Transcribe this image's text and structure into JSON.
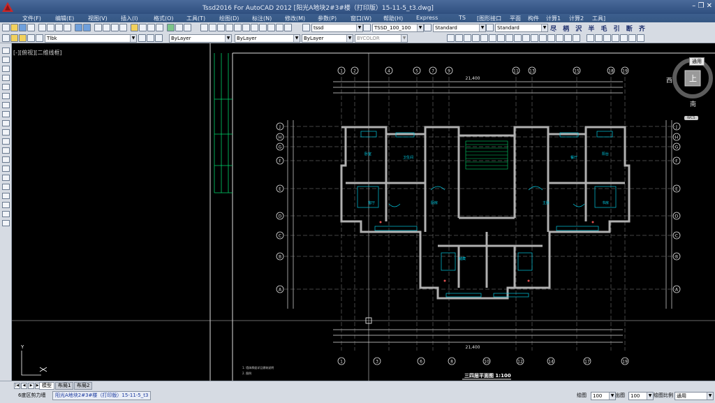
{
  "window": {
    "title": "Tssd2016 For AutoCAD 2012   [阳光A地块2#3#楼（打印版）15-11-5_t3.dwg]",
    "controls": "– ❐ ✕"
  },
  "menu": [
    "文件(F)",
    "编辑(E)",
    "视图(V)",
    "插入(I)",
    "格式(O)",
    "工具(T)",
    "绘图(D)",
    "标注(N)",
    "修改(M)",
    "参数(P)",
    "窗口(W)",
    "帮助(H)",
    "Express",
    "TS",
    "[图形接口",
    "平面",
    "构件",
    "计算1",
    "计算2",
    "工具]"
  ],
  "toolbar1": {
    "text_style": "tssd",
    "dim_style": "TSSD_100_100",
    "table_style": "Standard",
    "multileader_style": "Standard",
    "tssd_tools": "尽 柄 沢 半 毛 引 断 齐"
  },
  "toolbar2": {
    "layer": "Tlbk",
    "color": "ByLayer",
    "linetype": "ByLayer",
    "lineweight": "ByLayer",
    "plotstyle": "BYCOLOR"
  },
  "viewport": {
    "label": "[-][俯视][二维线框]"
  },
  "viewcube": {
    "top_face": "上",
    "west": "西",
    "south": "南",
    "ucs": "WCS",
    "dropdown": "通用"
  },
  "drawing": {
    "title": "三四层平面图 1:100",
    "total_width_top": "21,400",
    "total_width_bottom": "21,400",
    "top_axes": [
      "1",
      "2",
      "4",
      "5",
      "7",
      "9",
      "11",
      "13",
      "15",
      "18",
      "19"
    ],
    "bottom_axes": [
      "1",
      "3",
      "6",
      "8",
      "10",
      "12",
      "14",
      "17",
      "19"
    ],
    "left_axes": [
      "J",
      "H",
      "G",
      "F",
      "E",
      "D",
      "C",
      "B",
      "A"
    ],
    "rooms": [
      "卧室",
      "卫生间",
      "厨房",
      "客厅",
      "餐厅",
      "阳台",
      "主卧",
      "书房",
      "储藏"
    ],
    "notes": [
      "1. 墙体厚度详见建筑说明",
      "2. 图例"
    ]
  },
  "layout_tabs": [
    "模型",
    "布局1",
    "布局2"
  ],
  "command": "6度区剪力墙",
  "doc_tab": "阳光A地块2#3#楼（打印版）15-11-5_t3",
  "status": {
    "scale_label": "绘图",
    "scale_value": "100",
    "elev_label": "出图",
    "elev_value": "100",
    "annot_label": "绘图比例",
    "annot_value": "通用"
  }
}
